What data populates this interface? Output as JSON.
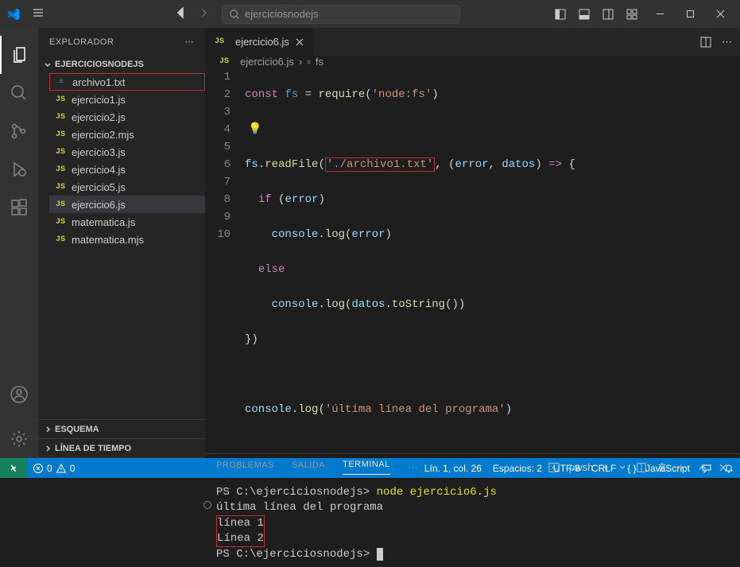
{
  "search": {
    "placeholder": "ejerciciosnodejs"
  },
  "sidebar": {
    "title": "EXPLORADOR",
    "folder": "EJERCICIOSNODEJS",
    "files": [
      {
        "name": "archivo1.txt",
        "icon": "≡",
        "iconClass": "txt",
        "highlighted": true
      },
      {
        "name": "ejercicio1.js",
        "icon": "JS",
        "iconClass": "js"
      },
      {
        "name": "ejercicio2.js",
        "icon": "JS",
        "iconClass": "js"
      },
      {
        "name": "ejercicio2.mjs",
        "icon": "JS",
        "iconClass": "js"
      },
      {
        "name": "ejercicio3.js",
        "icon": "JS",
        "iconClass": "js"
      },
      {
        "name": "ejercicio4.js",
        "icon": "JS",
        "iconClass": "js"
      },
      {
        "name": "ejercicio5.js",
        "icon": "JS",
        "iconClass": "js"
      },
      {
        "name": "ejercicio6.js",
        "icon": "JS",
        "iconClass": "js",
        "selected": true
      },
      {
        "name": "matematica.js",
        "icon": "JS",
        "iconClass": "js"
      },
      {
        "name": "matematica.mjs",
        "icon": "JS",
        "iconClass": "js"
      }
    ],
    "sections": [
      "ESQUEMA",
      "LÍNEA DE TIEMPO"
    ]
  },
  "tab": {
    "icon": "JS",
    "name": "ejercicio6.js"
  },
  "breadcrumb": {
    "file": "ejercicio6.js",
    "symbol": "fs"
  },
  "code": {
    "lines": [
      "1",
      "2",
      "3",
      "4",
      "5",
      "6",
      "7",
      "8",
      "9",
      "10"
    ],
    "l1_const": "const",
    "l1_fs": " fs ",
    "l1_eq": "= ",
    "l1_req": "require",
    "l1_p1": "(",
    "l1_str": "'node:fs'",
    "l1_p2": ")",
    "l3_fs": "fs",
    "l3_dot": ".",
    "l3_read": "readFile",
    "l3_p1": "(",
    "l3_str": "'./archivo1.txt'",
    "l3_c": ", (",
    "l3_err": "error",
    "l3_c2": ", ",
    "l3_dat": "datos",
    "l3_p2": ") ",
    "l3_ar": "=>",
    "l3_b": " {",
    "l4_if": "if",
    "l4_p1": " (",
    "l4_err": "error",
    "l4_p2": ")",
    "l5_con": "console",
    "l5_dot": ".",
    "l5_log": "log",
    "l5_p1": "(",
    "l5_err": "error",
    "l5_p2": ")",
    "l6_else": "else",
    "l7_con": "console",
    "l7_dot": ".",
    "l7_log": "log",
    "l7_p1": "(",
    "l7_dat": "datos",
    "l7_dot2": ".",
    "l7_ts": "toString",
    "l7_p2": "())",
    "l8": "})",
    "l10_con": "console",
    "l10_dot": ".",
    "l10_log": "log",
    "l10_p1": "(",
    "l10_str": "'última línea del programa'",
    "l10_p2": ")"
  },
  "panel": {
    "tabs": [
      "PROBLEMAS",
      "SALIDA",
      "TERMINAL"
    ],
    "shell": "pwsh"
  },
  "terminal": {
    "line1_prompt": "PS C:\\ejerciciosnodejs> ",
    "line1_cmd": "node ejercicio6.js",
    "line2": "última línea del programa",
    "line3": "línea 1",
    "line4": "Línea 2",
    "line5": "PS C:\\ejerciciosnodejs> "
  },
  "statusbar": {
    "errors": "0",
    "warnings": "0",
    "pos": "Lín. 1, col. 26",
    "spaces": "Espacios: 2",
    "enc": "UTF-8",
    "eol": "CRLF",
    "lang": "JavaScript"
  }
}
